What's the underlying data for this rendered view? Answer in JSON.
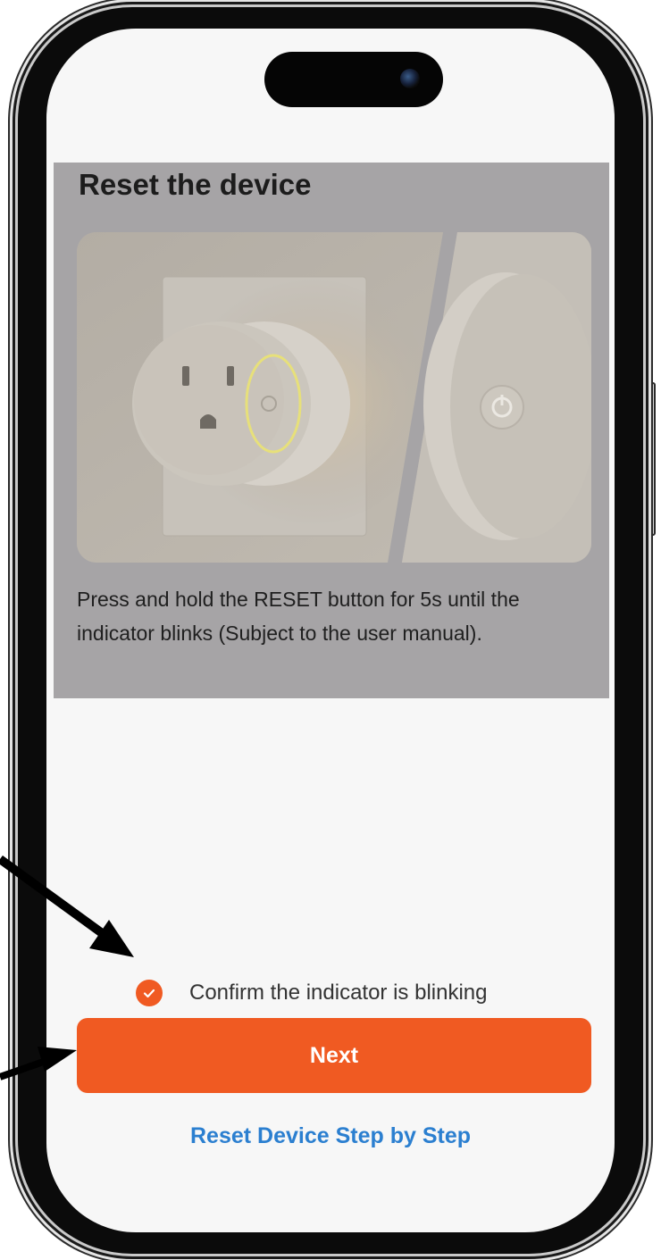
{
  "screen": {
    "title": "Reset the device",
    "instruction": "Press and hold the RESET button for 5s until the indicator blinks (Subject to the user manual).",
    "confirm_label": "Confirm the indicator is blinking",
    "confirm_checked": true,
    "next_label": "Next",
    "help_link": "Reset Device Step by Step"
  },
  "colors": {
    "accent": "#f05a22",
    "link": "#2b7fd0",
    "overlay_dim": "#a6a4a6"
  },
  "icons": {
    "check": "check-icon",
    "camera": "front-camera",
    "annotation": "arrow"
  }
}
